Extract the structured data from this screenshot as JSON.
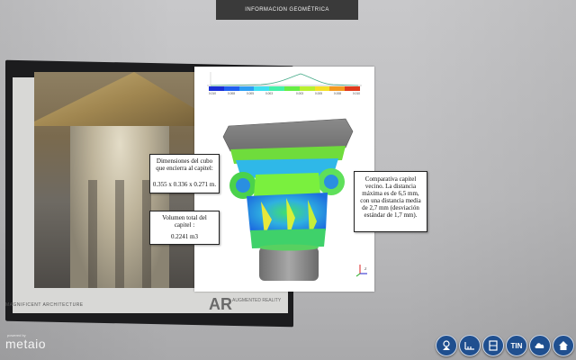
{
  "header": {
    "title": "INFORMACION GEOMÉTRICA"
  },
  "book": {
    "caption": "MAGNIFICENT ARCHITECTURE"
  },
  "ar_logo": {
    "mark": "AR",
    "subtitle": "AUGMENTED REALITY"
  },
  "scale": {
    "colors": [
      "#1a2fd6",
      "#1f5ff0",
      "#2c9ff3",
      "#3fe0f0",
      "#44f0a8",
      "#66ee44",
      "#b8f030",
      "#f4e028",
      "#f49a20",
      "#e03a1c"
    ],
    "ticks": [
      "0.010",
      "0.008",
      "0.005",
      "0.003",
      "",
      "0.003",
      "0.005",
      "0.008",
      "0.010"
    ]
  },
  "callouts": {
    "dimensions": {
      "title": "Dimensiones del cubo que encierra al capitel:",
      "value": "0.355 x 0.336 x 0.271 m."
    },
    "volume": {
      "title": "Volumen total del capitel :",
      "value": "0.2241 m3"
    },
    "comparison": {
      "text": "Comparativa capitel vecino. La distancia máxima es de 6,5 mm, con una distancia media de 2,7 mm (desviación estándar de 1,7 mm)."
    }
  },
  "branding": {
    "powered": "powered by",
    "name": "metaio"
  },
  "toolbar": {
    "items": [
      {
        "name": "model-icon"
      },
      {
        "name": "measure-icon"
      },
      {
        "name": "section-icon"
      },
      {
        "label": "TIN"
      },
      {
        "name": "cloud-icon"
      },
      {
        "name": "home-icon"
      }
    ]
  },
  "axis": {
    "label": "Z"
  }
}
